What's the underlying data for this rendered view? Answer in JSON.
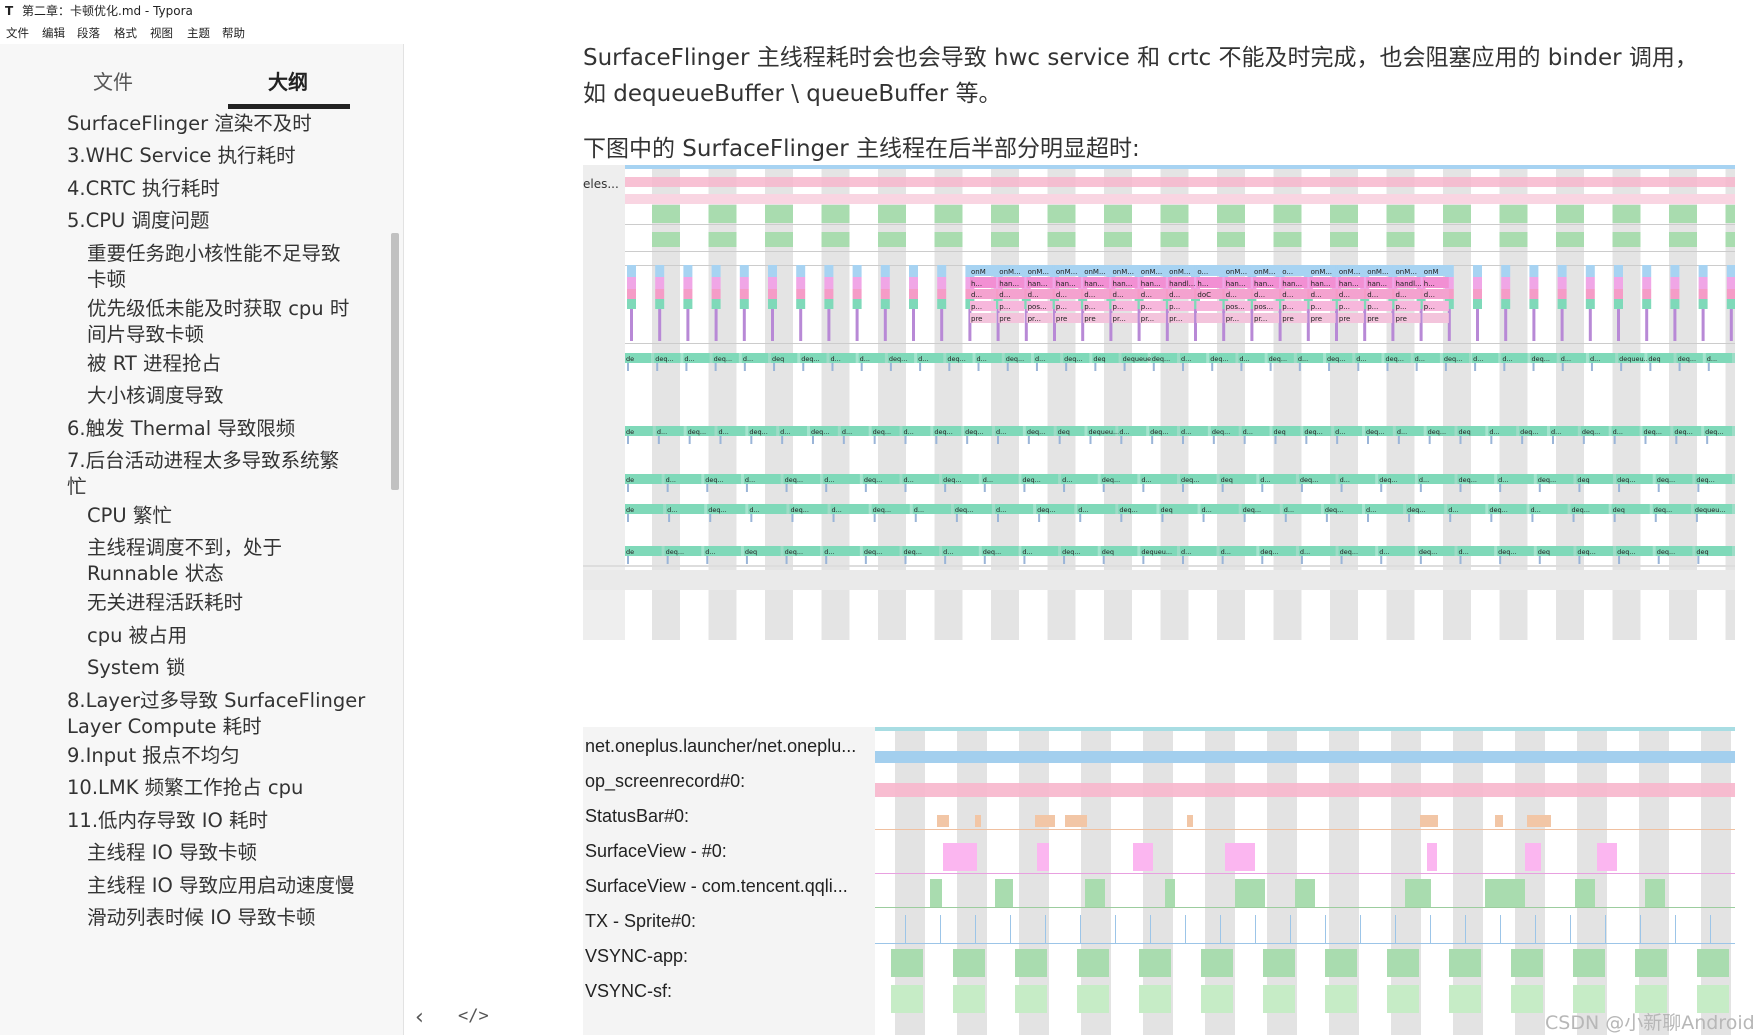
{
  "window": {
    "app_icon": "T",
    "title": "第二章：卡顿优化.md - Typora"
  },
  "menu": [
    "文件",
    "编辑",
    "段落",
    "格式",
    "视图",
    "主题",
    "帮助"
  ],
  "sidebar": {
    "tabs": {
      "files": "文件",
      "outline": "大纲"
    },
    "outline": [
      "SurfaceFlinger 渲染不及时",
      "3.WHC Service 执行耗时",
      "4.CRTC 执行耗时",
      "5.CPU 调度问题",
      [
        "重要任务跑小核性能不足导致",
        "卡顿"
      ],
      [
        "优先级低未能及时获取 cpu 时",
        "间片导致卡顿"
      ],
      "被 RT 进程抢占",
      "大小核调度导致",
      "6.触发 Thermal 导致限频",
      [
        "7.后台活动进程太多导致系统繁",
        "忙"
      ],
      "CPU 繁忙",
      [
        "主线程调度不到，处于",
        "Runnable 状态"
      ],
      "无关进程活跃耗时",
      "cpu 被占用",
      "System 锁",
      [
        "8.Layer过多导致 SurfaceFlinger",
        "Layer Compute 耗时"
      ],
      "9.Input 报点不均匀",
      "10.LMK 频繁工作抢占 cpu",
      "11.低内存导致 IO 耗时",
      "主线程 IO 导致卡顿",
      "主线程 IO 导致应用启动速度慢",
      "滑动列表时候 IO 导致卡顿"
    ],
    "bottom_left_icon": "chevron-left-icon",
    "bottom_code_icon": "code-icon",
    "bottom_left_glyph": "‹",
    "bottom_code_glyph": "</>"
  },
  "content": {
    "para1": "SurfaceFlinger 主线程耗时会也会导致 hwc service 和 crtc 不能及时完成，也会阻塞应用的 binder 调用，如 dequeueBuffer \\ queueBuffer 等。",
    "para2": "下图中的 SurfaceFlinger 主线程在后半部分明显超时:"
  },
  "trace1": {
    "left_label": "eles...",
    "onm_labels": [
      "onM",
      "onM...",
      "onM...",
      "onM...",
      "onM...",
      "onM...",
      "onM...",
      "onM...",
      "o...",
      "onM...",
      "onM...",
      "o...",
      "onM...",
      "onM...",
      "onM...",
      "onM...",
      "onM"
    ],
    "han_labels": [
      "h...",
      "han...",
      "han...",
      "han...",
      "han...",
      "han...",
      "han...",
      "handl...",
      "h...",
      "han...",
      "han...",
      "han...",
      "han...",
      "han...",
      "han...",
      "handl...",
      "h..."
    ],
    "d_labels": [
      "d...",
      "d...",
      "d...",
      "d...",
      "d...",
      "d...",
      "d...",
      "d...",
      "doC",
      "d...",
      "d...",
      "d...",
      "d...",
      "d...",
      "d...",
      "d...",
      "d..."
    ],
    "pos_labels": [
      "p...",
      "p...",
      "pos...",
      "p...",
      "p...",
      "p...",
      "p...",
      "p...",
      "",
      "pos...",
      "pos...",
      "p...",
      "p...",
      "p...",
      "p...",
      "p...",
      "p..."
    ],
    "pre_labels": [
      "pre",
      "pre",
      "pr...",
      "pre",
      "pre",
      "pr...",
      "pr...",
      "pr...",
      "",
      "pr...",
      "pr...",
      "pre",
      "pre",
      "pre",
      "pre",
      "pre",
      ""
    ],
    "deq_row1": [
      "de",
      "deq...",
      "d...",
      "deq...",
      "d...",
      "deq",
      "deq...",
      "d...",
      "d...",
      "deq...",
      "d...",
      "deq...",
      "d...",
      "deq...",
      "d...",
      "deq...",
      "deq",
      "dequeueBuffer",
      "deq...",
      "d...",
      "deq...",
      "d...",
      "deq...",
      "d...",
      "deq...",
      "d...",
      "deq...",
      "d...",
      "deq...",
      "d...",
      "d...",
      "deq...",
      "d...",
      "d...",
      "dequeu...",
      "deq",
      "deq...",
      "d..."
    ],
    "deq_row2": [
      "de",
      "d...",
      "deq...",
      "d...",
      "deq...",
      "d...",
      "deq...",
      "d...",
      "deq...",
      "d...",
      "deq...",
      "deq...",
      "d...",
      "deq...",
      "deq",
      "dequeu...",
      "d...",
      "deq...",
      "d...",
      "deq...",
      "d...",
      "deq",
      "deq...",
      "d...",
      "deq...",
      "d...",
      "deq...",
      "deq",
      "d...",
      "deq...",
      "d...",
      "deq...",
      "d...",
      "deq...",
      "deq...",
      "deq..."
    ],
    "deq_row3": [
      "de",
      "d...",
      "deq...",
      "d...",
      "deq...",
      "d...",
      "deq...",
      "d...",
      "deq...",
      "d...",
      "deq...",
      "d...",
      "deq...",
      "d...",
      "deq...",
      "deq",
      "d...",
      "deq...",
      "d...",
      "deq...",
      "d...",
      "deq...",
      "d...",
      "deq...",
      "deq",
      "deq...",
      "deq...",
      "deq..."
    ],
    "deq_row4": [
      "de",
      "d...",
      "deq...",
      "d...",
      "deq...",
      "d...",
      "deq...",
      "d...",
      "deq...",
      "d...",
      "deq...",
      "d...",
      "deq...",
      "deq",
      "d...",
      "deq...",
      "d...",
      "deq...",
      "d...",
      "deq...",
      "d...",
      "deq...",
      "d...",
      "deq...",
      "deq",
      "deq...",
      "dequeu..."
    ],
    "deq_row5": [
      "de",
      "deq...",
      "d...",
      "deq",
      "deq...",
      "d...",
      "deq...",
      "deq...",
      "d...",
      "deq...",
      "d...",
      "deq...",
      "deq",
      "dequeu...",
      "d...",
      "d...",
      "deq...",
      "d...",
      "deq...",
      "d...",
      "deq...",
      "d...",
      "deq...",
      "deq",
      "deq...",
      "deq...",
      "deq...",
      "deq"
    ]
  },
  "trace2": {
    "tracks": [
      "net.oneplus.launcher/net.oneplu...",
      "op_screenrecord#0:",
      "StatusBar#0:",
      "SurfaceView - #0:",
      "SurfaceView - com.tencent.qqli...",
      "TX - Sprite#0:",
      "VSYNC-app:",
      "VSYNC-sf:"
    ]
  },
  "watermark": "CSDN @小新聊Android",
  "colors": {
    "sidebar_bg": "#f7f7f7",
    "text": "#333333",
    "trace_grey": "#d9d9d9",
    "trace_pink": "#f7b6cc",
    "trace_blue": "#a7d3f2",
    "trace_green": "#a9dcaf",
    "trace_teal": "#7fd9b9",
    "trace_magenta": "#f0a6e6",
    "trace_orange": "#f2c6a6"
  }
}
